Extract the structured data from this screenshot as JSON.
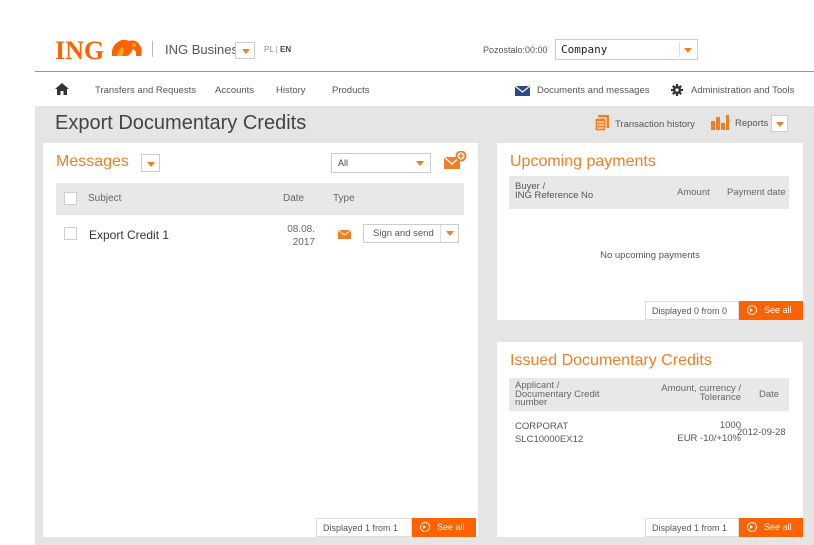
{
  "header": {
    "logo_text": "ING",
    "product": "ING Business",
    "lang_pl": "PL",
    "lang_sep": "|",
    "lang_en": "EN",
    "remaining": "Pozostalo:00:00",
    "company": "Company"
  },
  "nav": {
    "items": [
      "Transfers and Requests",
      "Accounts",
      "History",
      "Products"
    ],
    "documents": "Documents and messages",
    "admin": "Administration and Tools"
  },
  "page": {
    "title": "Export Documentary Credits",
    "transaction_history": "Transaction history",
    "reports": "Reports"
  },
  "messages": {
    "title": "Messages",
    "filter": "All",
    "columns": {
      "subject": "Subject",
      "date": "Date",
      "type": "Type"
    },
    "rows": [
      {
        "subject": "Export Credit 1",
        "date_line1": "08.08.",
        "date_line2": "2017",
        "action": "Sign and send"
      }
    ],
    "footer_count": "Displayed 1 from 1",
    "see_all": "See all"
  },
  "upcoming": {
    "title": "Upcoming payments",
    "col_buyer_1": "Buyer /",
    "col_buyer_2": "ING Reference No",
    "col_amount": "Amount",
    "col_date": "Payment date",
    "empty": "No upcoming payments",
    "footer_count": "Displayed 0 from 0",
    "see_all": "See all"
  },
  "issued": {
    "title": "Issued Documentary Credits",
    "col_applicant_1": "Applicant /",
    "col_applicant_2": "Documentary Credit",
    "col_applicant_3": "number",
    "col_amount_1": "Amount, currency /",
    "col_amount_2": "Tolerance",
    "col_date": "Date",
    "rows": [
      {
        "applicant": "CORPORAT",
        "number": "SLC10000EX12",
        "amount": "1000",
        "currency_tol": "EUR -10/+10%",
        "date": "2012-09-28"
      }
    ],
    "footer_count": "Displayed 1 from 1",
    "see_all": "See all"
  },
  "colors": {
    "accent": "#ee7f26",
    "brand": "#ff6200"
  },
  "icons": [
    "lion-logo-icon",
    "home-icon",
    "envelope-icon",
    "gear-icon",
    "document-icon",
    "bar-chart-icon",
    "new-message-icon",
    "play-circle-icon",
    "chevron-down-icon"
  ]
}
